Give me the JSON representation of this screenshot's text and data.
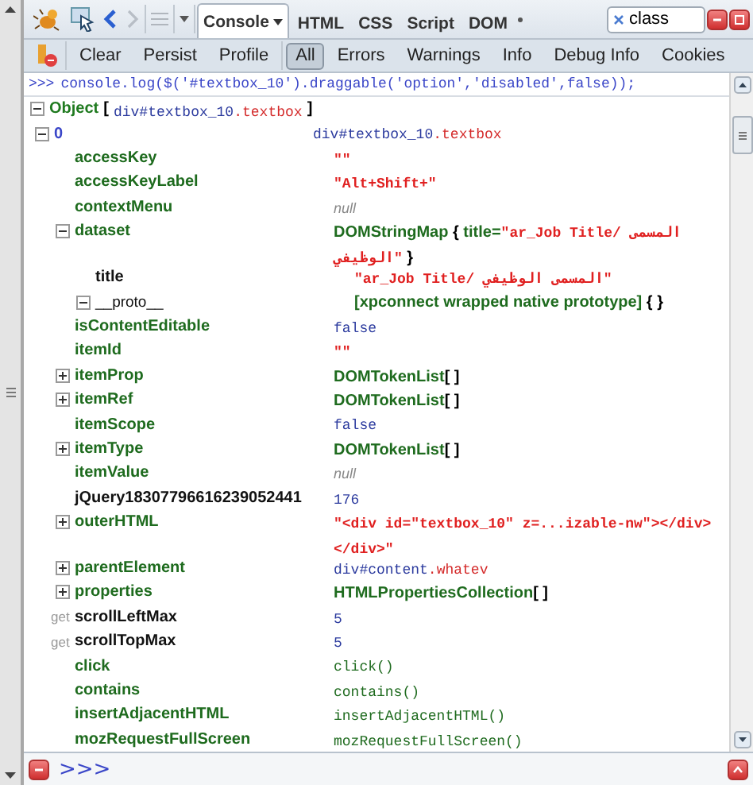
{
  "toolbar": {
    "tabs": [
      {
        "label": "Console",
        "selected": true,
        "dropdown": true
      },
      {
        "label": "HTML",
        "selected": false,
        "dropdown": false
      },
      {
        "label": "CSS",
        "selected": false,
        "dropdown": false
      },
      {
        "label": "Script",
        "selected": false,
        "dropdown": false
      },
      {
        "label": "DOM",
        "selected": false,
        "dropdown": false
      }
    ],
    "search": {
      "value": "class"
    }
  },
  "filters": {
    "actions": [
      "Clear",
      "Persist",
      "Profile"
    ],
    "levels": [
      {
        "label": "All",
        "selected": true
      },
      {
        "label": "Errors",
        "selected": false
      },
      {
        "label": "Warnings",
        "selected": false
      },
      {
        "label": "Info",
        "selected": false
      },
      {
        "label": "Debug Info",
        "selected": false
      },
      {
        "label": "Cookies",
        "selected": false
      }
    ]
  },
  "command": {
    "prompt": ">>>",
    "text": "console.log($('#textbox_10').draggable('option','disabled',false));"
  },
  "object": {
    "expanded": true,
    "label": "Object",
    "open": "[",
    "close": "]",
    "value": [
      {
        "kind": "tag",
        "text": "div#textbox_10"
      },
      {
        "kind": "class",
        "text": ".textbox"
      }
    ]
  },
  "tree": [
    {
      "name": "0",
      "kind": "index",
      "expanded": true,
      "value": [
        {
          "kind": "tag",
          "text": "div#textbox_10"
        },
        {
          "kind": "class",
          "text": ".textbox"
        }
      ],
      "children": [
        {
          "name": "accessKey",
          "kind": "property",
          "value": [
            {
              "kind": "string",
              "text": "\"\""
            }
          ]
        },
        {
          "name": "accessKeyLabel",
          "kind": "property",
          "value": [
            {
              "kind": "string",
              "text": "\"Alt+Shift+\""
            }
          ]
        },
        {
          "name": "contextMenu",
          "kind": "property",
          "value": [
            {
              "kind": "null",
              "text": "null"
            }
          ]
        },
        {
          "name": "dataset",
          "kind": "property",
          "expanded": true,
          "value": [
            {
              "kind": "object",
              "text": "DOMStringMap"
            },
            {
              "kind": "brace",
              "text": " { "
            },
            {
              "kind": "object",
              "text": "title="
            },
            {
              "kind": "string",
              "text": "\"ar_Job Title/ المسمى الوظيفي\""
            },
            {
              "kind": "brace",
              "text": " }"
            }
          ],
          "children": [
            {
              "name": "title",
              "kind": "own",
              "value": [
                {
                  "kind": "string",
                  "text": "\"ar_Job Title/ المسمى الوظيفي\""
                }
              ]
            },
            {
              "name": "__proto__",
              "kind": "proto",
              "expanded": true,
              "value": [
                {
                  "kind": "object",
                  "text": "[xpconnect wrapped native prototype]"
                },
                {
                  "kind": "brace",
                  "text": " {  }"
                }
              ]
            }
          ]
        },
        {
          "name": "isContentEditable",
          "kind": "property",
          "value": [
            {
              "kind": "plain",
              "text": "false"
            }
          ]
        },
        {
          "name": "itemId",
          "kind": "property",
          "value": [
            {
              "kind": "string",
              "text": "\"\""
            }
          ]
        },
        {
          "name": "itemProp",
          "kind": "property",
          "expanded": false,
          "value": [
            {
              "kind": "object",
              "text": "DOMTokenList"
            },
            {
              "kind": "brace",
              "text": "[  ]"
            }
          ]
        },
        {
          "name": "itemRef",
          "kind": "property",
          "expanded": false,
          "value": [
            {
              "kind": "object",
              "text": "DOMTokenList"
            },
            {
              "kind": "brace",
              "text": "[  ]"
            }
          ]
        },
        {
          "name": "itemScope",
          "kind": "property",
          "value": [
            {
              "kind": "plain",
              "text": "false"
            }
          ]
        },
        {
          "name": "itemType",
          "kind": "property",
          "expanded": false,
          "value": [
            {
              "kind": "object",
              "text": "DOMTokenList"
            },
            {
              "kind": "brace",
              "text": "[  ]"
            }
          ]
        },
        {
          "name": "itemValue",
          "kind": "property",
          "value": [
            {
              "kind": "null",
              "text": "null"
            }
          ]
        },
        {
          "name": "jQuery18307796616239052441",
          "kind": "own",
          "value": [
            {
              "kind": "plain",
              "text": "176"
            }
          ]
        },
        {
          "name": "outerHTML",
          "kind": "property",
          "expanded": false,
          "value": [
            {
              "kind": "string",
              "text": "\"<div id=\"textbox_10\" z=...izable-nw\"></div> </div>\""
            }
          ]
        },
        {
          "name": "parentElement",
          "kind": "property",
          "expanded": false,
          "value": [
            {
              "kind": "tag",
              "text": "div#content"
            },
            {
              "kind": "class",
              "text": ".whatev"
            }
          ]
        },
        {
          "name": "properties",
          "kind": "property",
          "expanded": false,
          "value": [
            {
              "kind": "object",
              "text": "HTMLPropertiesCollection"
            },
            {
              "kind": "brace",
              "text": "[  ]"
            }
          ]
        },
        {
          "name": "scrollLeftMax",
          "kind": "getter",
          "prefix": "get",
          "value": [
            {
              "kind": "plain",
              "text": "5"
            }
          ]
        },
        {
          "name": "scrollTopMax",
          "kind": "getter",
          "prefix": "get",
          "value": [
            {
              "kind": "plain",
              "text": "5"
            }
          ]
        },
        {
          "name": "click",
          "kind": "property",
          "value": [
            {
              "kind": "function",
              "text": "click()"
            }
          ]
        },
        {
          "name": "contains",
          "kind": "property",
          "value": [
            {
              "kind": "function",
              "text": "contains()"
            }
          ]
        },
        {
          "name": "insertAdjacentHTML",
          "kind": "property",
          "value": [
            {
              "kind": "function",
              "text": "insertAdjacentHTML()"
            }
          ]
        },
        {
          "name": "mozRequestFullScreen",
          "kind": "property",
          "value": [
            {
              "kind": "function",
              "text": "mozRequestFullScreen()"
            }
          ]
        }
      ]
    }
  ],
  "command_line": {
    "prompt": ">>>"
  }
}
